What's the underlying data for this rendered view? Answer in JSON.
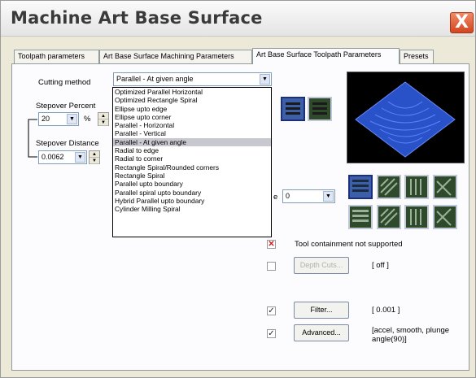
{
  "window": {
    "title": "Machine Art Base Surface",
    "close_label": "X"
  },
  "tabs": [
    {
      "label": "Toolpath parameters"
    },
    {
      "label": "Art Base Surface Machining Parameters"
    },
    {
      "label": "Art Base Surface Toolpath Parameters"
    },
    {
      "label": "Presets"
    }
  ],
  "form": {
    "cutting_method_label": "Cutting method",
    "cutting_method_value": "Parallel - At given angle",
    "stepover_percent_label": "Stepover Percent",
    "stepover_percent_value": "20",
    "stepover_percent_unit": "%",
    "stepover_distance_label": "Stepover Distance",
    "stepover_distance_value": "0.0062",
    "partial_label": "e",
    "angle_value": "0"
  },
  "dropdown_options": [
    "Optimized Parallel Horizontal",
    "Optimized Rectangle Spiral",
    "Ellipse upto edge",
    "Ellipse upto corner",
    "Parallel - Horizontal",
    "Parallel - Vertical",
    "Parallel - At given angle",
    "Radial to edge",
    "Radial to corner",
    "Rectangle Spiral/Rounded corners",
    "Rectangle Spiral",
    "Parallel upto boundary",
    "Parallel spiral upto boundary",
    "Hybrid Parallel upto boundary",
    "Cylinder Milling Spiral"
  ],
  "dropdown_selected_index": 6,
  "options": {
    "tool_containment_label": "Tool containment not supported",
    "depth_cuts_button": "Depth Cuts...",
    "depth_cuts_status": "[ off ]",
    "filter_button": "Filter...",
    "filter_status": "[ 0.001 ]",
    "advanced_button": "Advanced...",
    "advanced_status_line1": "[accel, smooth, plunge",
    "advanced_status_line2": "angle(90)]"
  },
  "colors": {
    "preview_surface": "#2a52c8",
    "close_button": "#d2451f",
    "selected_pattern_button": "#3c5fa8"
  }
}
